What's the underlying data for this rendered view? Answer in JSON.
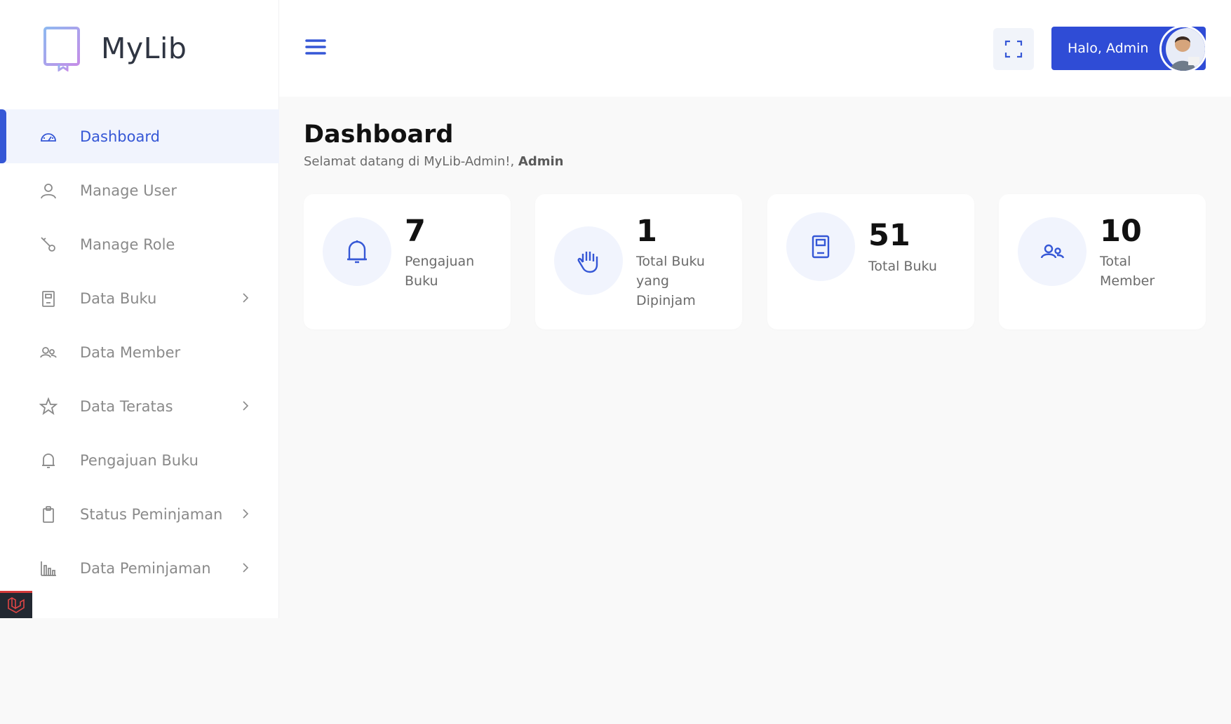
{
  "app": {
    "name": "MyLib"
  },
  "colors": {
    "accent": "#3557d6",
    "icon_bg": "#f1f4fd",
    "muted_text": "#8a8a8a"
  },
  "sidebar": {
    "items": [
      {
        "label": "Dashboard",
        "icon": "dashboard-gauge-icon",
        "active": true,
        "has_submenu": false
      },
      {
        "label": "Manage User",
        "icon": "user-icon",
        "active": false,
        "has_submenu": false
      },
      {
        "label": "Manage Role",
        "icon": "key-icon",
        "active": false,
        "has_submenu": false
      },
      {
        "label": "Data Buku",
        "icon": "book-icon",
        "active": false,
        "has_submenu": true
      },
      {
        "label": "Data Member",
        "icon": "users-icon",
        "active": false,
        "has_submenu": false
      },
      {
        "label": "Data Teratas",
        "icon": "star-icon",
        "active": false,
        "has_submenu": true
      },
      {
        "label": "Pengajuan Buku",
        "icon": "bell-icon",
        "active": false,
        "has_submenu": false
      },
      {
        "label": "Status Peminjaman",
        "icon": "clipboard-icon",
        "active": false,
        "has_submenu": true
      },
      {
        "label": "Data Peminjaman",
        "icon": "bar-chart-icon",
        "active": false,
        "has_submenu": true
      }
    ]
  },
  "header": {
    "greeting": "Halo, Admin"
  },
  "main": {
    "title": "Dashboard",
    "welcome_prefix": "Selamat datang di MyLib-Admin!, ",
    "welcome_name": "Admin",
    "cards": [
      {
        "value": "7",
        "label": "Pengajuan Buku",
        "icon": "bell-icon"
      },
      {
        "value": "1",
        "label": "Total Buku yang Dipinjam",
        "icon": "hand-icon"
      },
      {
        "value": "51",
        "label": "Total Buku",
        "icon": "book-icon"
      },
      {
        "value": "10",
        "label": "Total Member",
        "icon": "users-icon"
      }
    ]
  }
}
